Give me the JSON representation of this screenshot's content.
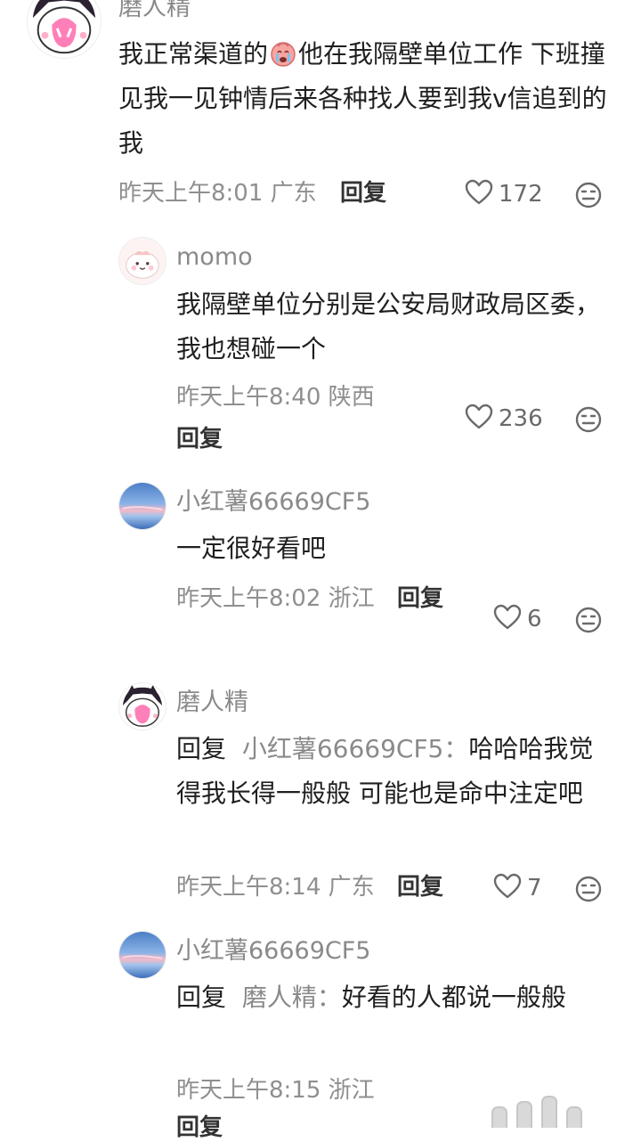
{
  "comments": [
    {
      "username": "磨人精",
      "text_before": "我正常渠道的",
      "text_after": "他在我隔壁单位工作 下班撞见我一见钟情后来各种找人要到我v信追到的我",
      "inline_emoji": "crying-face-emoji",
      "time": "昨天上午8:01",
      "location": "广东",
      "reply_label": "回复",
      "likes": "172"
    },
    {
      "username": "momo",
      "text": "我隔壁单位分别是公安局财政局区委，我也想碰一个",
      "time": "昨天上午8:40",
      "location": "陕西",
      "reply_label": "回复",
      "likes": "236"
    },
    {
      "username": "小红薯66669CF5",
      "text": "一定很好看吧",
      "time": "昨天上午8:02",
      "location": "浙江",
      "reply_label": "回复",
      "likes": "6"
    },
    {
      "username": "磨人精",
      "reply_prefix": "回复",
      "reply_to": "小红薯66669CF5：",
      "text": "哈哈哈我觉得我长得一般般 可能也是命中注定吧",
      "time": "昨天上午8:14",
      "location": "广东",
      "reply_label": "回复",
      "likes": "7"
    },
    {
      "username": "小红薯66669CF5",
      "reply_prefix": "回复",
      "reply_to": "磨人精：",
      "text": "好看的人都说一般般",
      "time": "昨天上午8:15",
      "location": "浙江",
      "reply_label": "回复"
    }
  ],
  "icons": {
    "like": "heart-outline-icon",
    "emoji": "emoji-face-icon"
  },
  "colors": {
    "text": "#1f1f1f",
    "meta": "#8f8f8f",
    "username": "#8a8a8a"
  }
}
